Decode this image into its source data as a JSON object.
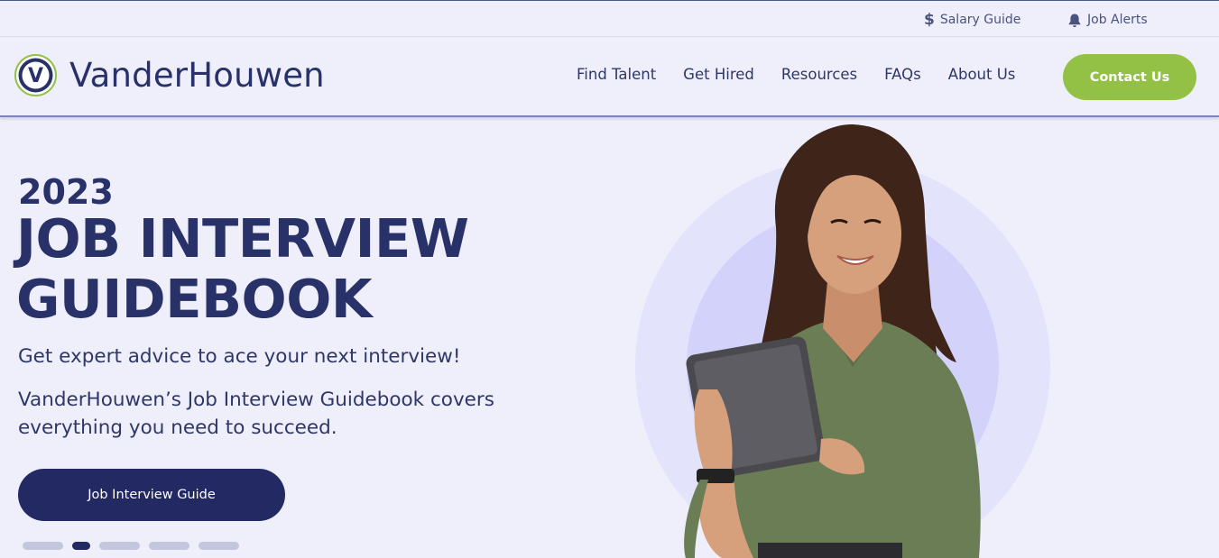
{
  "utility_bar": {
    "salary_guide": "Salary Guide",
    "job_alerts": "Job Alerts"
  },
  "header": {
    "logo_text": "VanderHouwen",
    "logo_letter": "V",
    "nav": [
      "Find Talent",
      "Get Hired",
      "Resources",
      "FAQs",
      "About Us"
    ],
    "contact_label": "Contact Us"
  },
  "hero": {
    "year": "2023",
    "title_line1": "JOB INTERVIEW",
    "title_line2": "GUIDEBOOK",
    "subtitle": "Get expert advice to ace your next interview!",
    "description": "VanderHouwen’s Job Interview Guidebook covers everything you need to succeed.",
    "cta_label": "Job Interview Guide",
    "slides": {
      "total": 5,
      "active": 2
    }
  },
  "icons": {
    "salary": "dollar-icon",
    "alerts": "bell-icon"
  },
  "colors": {
    "page_bg": "#efeffb",
    "brand_navy": "#283168",
    "accent_green": "#92c146",
    "cta_navy": "#232a63"
  }
}
